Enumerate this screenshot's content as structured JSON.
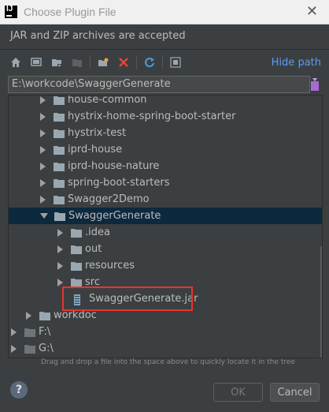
{
  "window": {
    "title": "Choose Plugin File",
    "app_icon_label": "IJ",
    "close_glyph": "✕"
  },
  "subtitle": "JAR and ZIP archives are accepted",
  "toolbar": {
    "buttons": [
      "home-icon",
      "desktop-icon",
      "project-icon",
      "module-icon",
      "new-folder-icon",
      "delete-icon",
      "refresh-icon",
      "show-hidden-icon"
    ],
    "hide_path_label": "Hide path"
  },
  "path_field": {
    "value": "E:\\workcode\\SwaggerGenerate"
  },
  "tree": {
    "items": [
      {
        "label": "house-common",
        "type": "folder",
        "expanded": false
      },
      {
        "label": "hystrix-home-spring-boot-starter",
        "type": "folder",
        "expanded": false
      },
      {
        "label": "hystrix-test",
        "type": "folder",
        "expanded": false
      },
      {
        "label": "iprd-house",
        "type": "folder",
        "expanded": false
      },
      {
        "label": "iprd-house-nature",
        "type": "folder",
        "expanded": false
      },
      {
        "label": "spring-boot-starters",
        "type": "folder",
        "expanded": false
      },
      {
        "label": "Swagger2Demo",
        "type": "folder",
        "expanded": false
      },
      {
        "label": "SwaggerGenerate",
        "type": "folder",
        "expanded": true,
        "selected": true
      },
      {
        "label": ".idea",
        "type": "folder",
        "expanded": false
      },
      {
        "label": "out",
        "type": "folder",
        "expanded": false
      },
      {
        "label": "resources",
        "type": "folder",
        "expanded": false
      },
      {
        "label": "src",
        "type": "folder",
        "expanded": false
      },
      {
        "label": "SwaggerGenerate.jar",
        "type": "jar"
      },
      {
        "label": "workdoc",
        "type": "folder",
        "expanded": false
      },
      {
        "label": "F:\\",
        "type": "drive",
        "expanded": false
      },
      {
        "label": "G:\\",
        "type": "drive",
        "expanded": false
      }
    ]
  },
  "hint": "Drag and drop a file into the space above to quickly locate it in the tree",
  "buttons": {
    "help": "?",
    "ok": "OK",
    "cancel": "Cancel"
  },
  "colors": {
    "background": "#3c3f41",
    "selection": "#0d293e",
    "link": "#589df6",
    "highlight_box": "#e8342c"
  }
}
